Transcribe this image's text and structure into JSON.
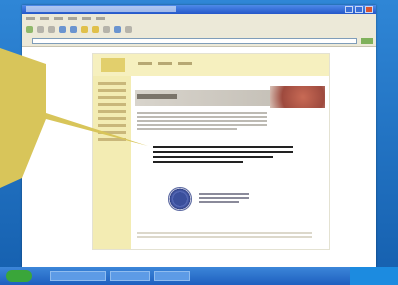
{
  "icons": {
    "close": "close-icon",
    "start": "windows-start-icon",
    "seal": "seal-icon"
  },
  "colors": {
    "desktop_blue": "#1d6fbe",
    "callout_yellow": "#d8c55a",
    "taskbar_blue": "#1e5fbf",
    "page_header_yellow": "#f6f0bf"
  }
}
